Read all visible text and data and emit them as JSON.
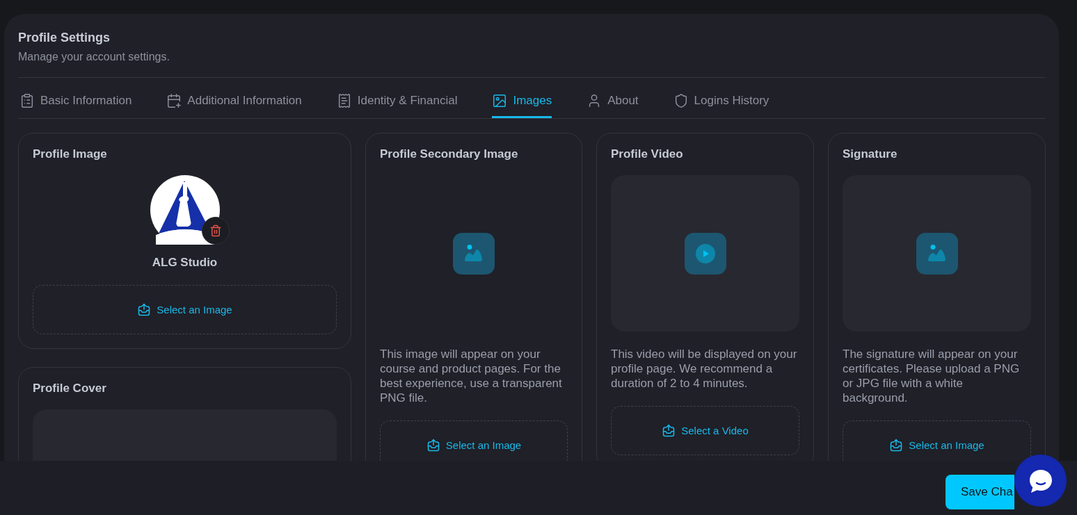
{
  "header": {
    "title": "Profile Settings",
    "subtitle": "Manage your account settings."
  },
  "tabs": [
    {
      "label": "Basic Information",
      "selected": false
    },
    {
      "label": "Additional Information",
      "selected": false
    },
    {
      "label": "Identity & Financial",
      "selected": false
    },
    {
      "label": "Images",
      "selected": true
    },
    {
      "label": "About",
      "selected": false
    },
    {
      "label": "Logins History",
      "selected": false
    }
  ],
  "columns": [
    [
      {
        "kind": "avatar",
        "title": "Profile Image",
        "name": "ALG Studio",
        "upload": "Select an Image"
      },
      {
        "kind": "cover",
        "title": "Profile Cover"
      }
    ],
    [
      {
        "kind": "image",
        "title": "Profile Secondary Image",
        "description": "This image will appear on your course and product pages. For the best experience, use a transparent PNG file.",
        "upload": "Select an Image"
      }
    ],
    [
      {
        "kind": "video",
        "title": "Profile Video",
        "description": "This video will be displayed on your profile page. We recommend a duration of 2 to 4 minutes.",
        "upload": "Select a Video"
      }
    ],
    [
      {
        "kind": "signature",
        "title": "Signature",
        "description": "The signature will appear on your certificates. Please upload a PNG or JPG file with a white background.",
        "upload": "Select an Image"
      }
    ]
  ],
  "footer": {
    "save_button": "Save Cha"
  }
}
